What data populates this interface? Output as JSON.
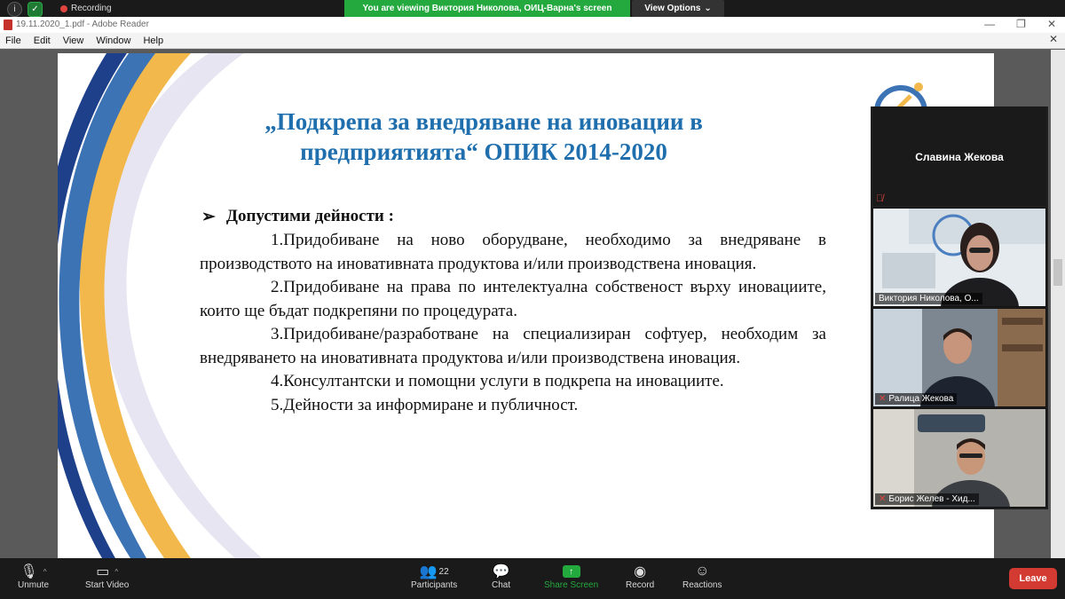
{
  "zoom": {
    "recording_label": "Recording",
    "viewing_banner": "You are viewing Виктория Николова, ОИЦ-Варна's screen",
    "view_options": "View Options",
    "toolbar": {
      "unmute": "Unmute",
      "start_video": "Start Video",
      "participants": "Participants",
      "participants_count": "22",
      "chat": "Chat",
      "share_screen": "Share Screen",
      "record": "Record",
      "reactions": "Reactions",
      "leave": "Leave"
    },
    "colors": {
      "banner_green": "#23a93e",
      "leave_red": "#d23a32"
    }
  },
  "window": {
    "title": "19.11.2020_1.pdf - Adobe Reader",
    "menu": [
      "File",
      "Edit",
      "View",
      "Window",
      "Help"
    ]
  },
  "slide": {
    "title_line1": "„Подкрепа за внедряване на иновации в",
    "title_line2": "предприятията“  ОПИК 2014-2020",
    "section_heading": "Допустими дейности :",
    "items": [
      "1.Придобиване на ново оборудване, необходимо за внедряване в производството на иновативната продуктова и/или производствена иновация.",
      "2.Придобиване на права по интелектуална собственост върху иновациите, които ще бъдат подкрепяни по процедурата.",
      "3.Придобиване/разработване на специализиран софтуер, необходим за внедряването на иновативната продуктова и/или производствена иновация.",
      "4.Консултантски и помощни услуги в подкрепа на иновациите.",
      "5.Дейности за информиране и публичност."
    ],
    "title_color": "#1f6fae"
  },
  "participants": [
    {
      "name": "Славина Жекова"
    },
    {
      "name": "Виктория Николова, О..."
    },
    {
      "name": "Ралица Жекова"
    },
    {
      "name": "Борис Желев - Хид..."
    }
  ]
}
